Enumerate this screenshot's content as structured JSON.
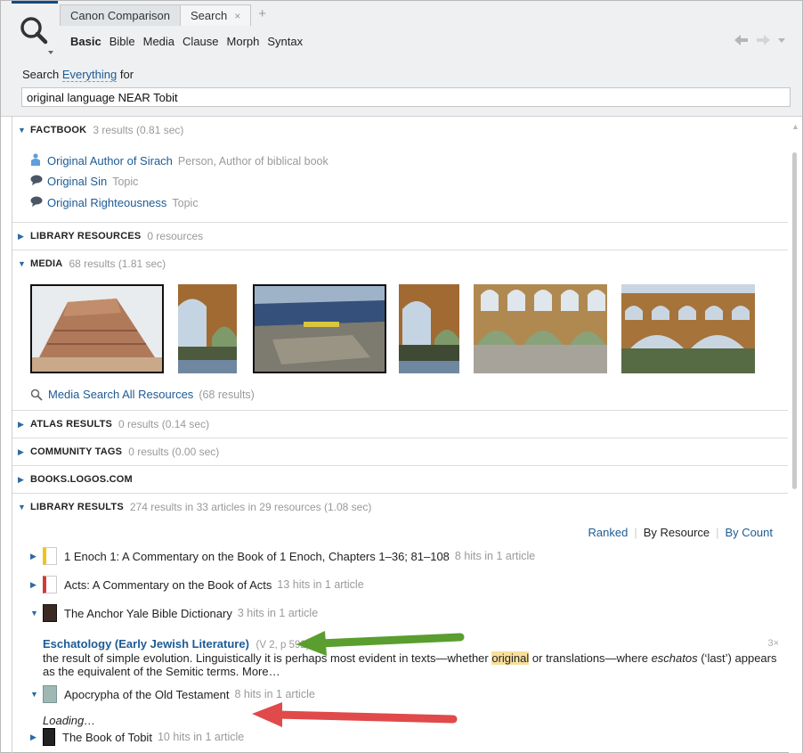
{
  "tabs": [
    {
      "label": "Canon Comparison"
    },
    {
      "label": "Search",
      "close": "×"
    }
  ],
  "tab_add": "+",
  "modes": [
    "Basic",
    "Bible",
    "Media",
    "Clause",
    "Morph",
    "Syntax"
  ],
  "search": {
    "prefix": "Search",
    "scope": "Everything",
    "suffix": "for",
    "query": "original language NEAR Tobit"
  },
  "sections": {
    "factbook": {
      "title": "FACTBOOK",
      "count": "3 results (0.81 sec)"
    },
    "library_resources": {
      "title": "LIBRARY RESOURCES",
      "count": "0 resources"
    },
    "media": {
      "title": "MEDIA",
      "count": "68 results (1.81 sec)"
    },
    "atlas": {
      "title": "ATLAS RESULTS",
      "count": "0 results (0.14 sec)"
    },
    "community": {
      "title": "COMMUNITY TAGS",
      "count": "0 results (0.00 sec)"
    },
    "books": {
      "title": "BOOKS.LOGOS.COM",
      "count": ""
    },
    "library_results": {
      "title": "LIBRARY RESULTS",
      "count": "274 results in 33 articles in 29 resources (1.08 sec)"
    }
  },
  "factbook_items": [
    {
      "label": "Original Author of Sirach",
      "type": "Person, Author of biblical book",
      "icon": "person-icon"
    },
    {
      "label": "Original Sin",
      "type": "Topic",
      "icon": "topic-icon"
    },
    {
      "label": "Original Righteousness",
      "type": "Topic",
      "icon": "topic-icon"
    }
  ],
  "media_link": {
    "label": "Media Search All Resources",
    "count": "(68 results)"
  },
  "sort": {
    "ranked": "Ranked",
    "by_resource": "By Resource",
    "by_count": "By Count"
  },
  "library_items": [
    {
      "title": "1 Enoch 1: A Commentary on the Book of 1 Enoch, Chapters 1–36; 81–108",
      "hits": "8 hits in 1 article",
      "color": "#f0c419"
    },
    {
      "title": "Acts: A Commentary on the Book of Acts",
      "hits": "13 hits in 1 article",
      "color": "#d13b3b"
    },
    {
      "title": "The Anchor Yale Bible Dictionary",
      "hits": "3 hits in 1 article",
      "color": "#3a2a22"
    },
    {
      "title": "Apocrypha of the Old Testament",
      "hits": "8 hits in 1 article",
      "color": "#9fb8b6"
    },
    {
      "title": "The Book of Tobit",
      "hits": "10 hits in 1 article",
      "color": "#222222"
    }
  ],
  "excerpt": {
    "title": "Eschatology (Early Jewish Literature)",
    "ref": "(V 2, p 592)",
    "times": "3×",
    "text_before": "the result of simple evolution. Linguistically it is perhaps most evident in texts—whether ",
    "highlight": "original",
    "text_mid": " or translations—where ",
    "italic": "eschatos",
    "text_after": " (‘last’) appears as the equivalent of the Semitic terms. More…"
  },
  "loading": "Loading…",
  "colors": {
    "accent": "#1d5b94",
    "highlight": "#f8df9b",
    "arrow_green": "#5a9e2f",
    "arrow_red": "#e04a4a"
  }
}
